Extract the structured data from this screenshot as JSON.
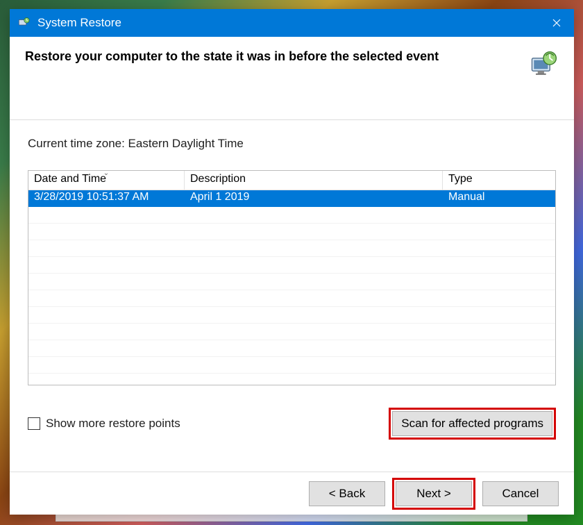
{
  "titlebar": {
    "title": "System Restore"
  },
  "header": {
    "heading": "Restore your computer to the state it was in before the selected event"
  },
  "content": {
    "timezone_label": "Current time zone: Eastern Daylight Time",
    "columns": {
      "date": "Date and Time",
      "desc": "Description",
      "type": "Type"
    },
    "rows": [
      {
        "date": "3/28/2019 10:51:37 AM",
        "desc": "April 1 2019",
        "type": "Manual"
      }
    ],
    "show_more_label": "Show more restore points",
    "scan_label": "Scan for affected programs"
  },
  "footer": {
    "back": "< Back",
    "next": "Next >",
    "cancel": "Cancel"
  }
}
